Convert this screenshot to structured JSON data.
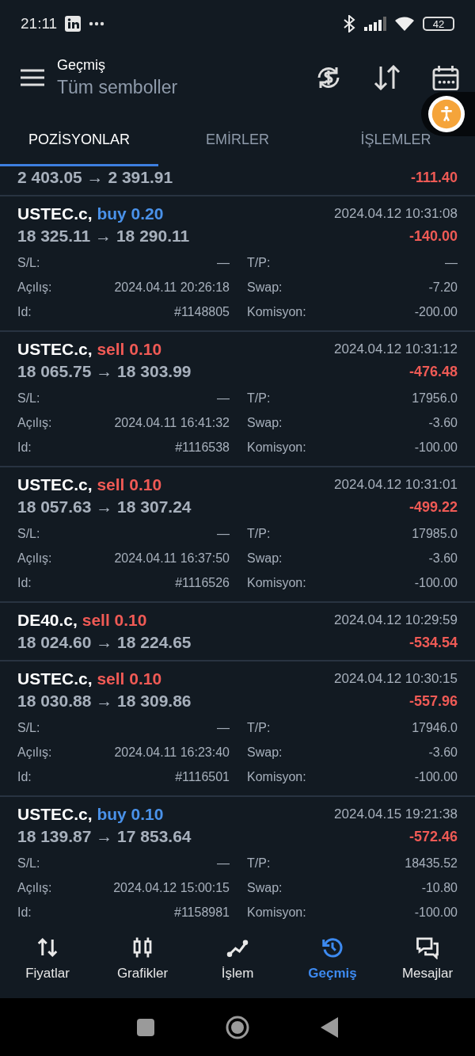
{
  "status_bar": {
    "time": "21:11",
    "battery": "42"
  },
  "header": {
    "title": "Geçmiş",
    "subtitle": "Tüm semboller"
  },
  "tabs": [
    {
      "label": "POZİSYONLAR",
      "selected": true
    },
    {
      "label": "EMİRLER",
      "selected": false
    },
    {
      "label": "İŞLEMLER",
      "selected": false
    }
  ],
  "deals": [
    {
      "kind": "partial",
      "prices": "2 403.05 → 2 391.91",
      "profit": "-111.40"
    },
    {
      "kind": "expanded",
      "symbol": "USTEC.c,",
      "sell": false,
      "order": "buy 0.20",
      "time": "2024.04.12 10:31:08",
      "prices": "18 325.11 → 18 290.11",
      "profit": "-140.00",
      "details": [
        {
          "label": "S/L:",
          "value": "—"
        },
        {
          "label": "T/P:",
          "value": "—"
        },
        {
          "label": "Açılış:",
          "value": "2024.04.11 20:26:18"
        },
        {
          "label": "Swap:",
          "value": "-7.20"
        },
        {
          "label": "Id:",
          "value": "#1148805"
        },
        {
          "label": "Komisyon:",
          "value": "-200.00"
        }
      ]
    },
    {
      "kind": "expanded",
      "symbol": "USTEC.c,",
      "sell": true,
      "order": "sell 0.10",
      "time": "2024.04.12 10:31:12",
      "prices": "18 065.75 → 18 303.99",
      "profit": "-476.48",
      "details": [
        {
          "label": "S/L:",
          "value": "—"
        },
        {
          "label": "T/P:",
          "value": "17956.0"
        },
        {
          "label": "Açılış:",
          "value": "2024.04.11 16:41:32"
        },
        {
          "label": "Swap:",
          "value": "-3.60"
        },
        {
          "label": "Id:",
          "value": "#1116538"
        },
        {
          "label": "Komisyon:",
          "value": "-100.00"
        }
      ]
    },
    {
      "kind": "expanded",
      "symbol": "USTEC.c,",
      "sell": true,
      "order": "sell 0.10",
      "time": "2024.04.12 10:31:01",
      "prices": "18 057.63 → 18 307.24",
      "profit": "-499.22",
      "details": [
        {
          "label": "S/L:",
          "value": "—"
        },
        {
          "label": "T/P:",
          "value": "17985.0"
        },
        {
          "label": "Açılış:",
          "value": "2024.04.11 16:37:50"
        },
        {
          "label": "Swap:",
          "value": "-3.60"
        },
        {
          "label": "Id:",
          "value": "#1116526"
        },
        {
          "label": "Komisyon:",
          "value": "-100.00"
        }
      ]
    },
    {
      "kind": "collapsed",
      "symbol": "DE40.c,",
      "sell": true,
      "order": "sell 0.10",
      "time": "2024.04.12 10:29:59",
      "prices": "18 024.60 → 18 224.65",
      "profit": "-534.54"
    },
    {
      "kind": "expanded",
      "symbol": "USTEC.c,",
      "sell": true,
      "order": "sell 0.10",
      "time": "2024.04.12 10:30:15",
      "prices": "18 030.88 → 18 309.86",
      "profit": "-557.96",
      "details": [
        {
          "label": "S/L:",
          "value": "—"
        },
        {
          "label": "T/P:",
          "value": "17946.0"
        },
        {
          "label": "Açılış:",
          "value": "2024.04.11 16:23:40"
        },
        {
          "label": "Swap:",
          "value": "-3.60"
        },
        {
          "label": "Id:",
          "value": "#1116501"
        },
        {
          "label": "Komisyon:",
          "value": "-100.00"
        }
      ]
    },
    {
      "kind": "expanded",
      "symbol": "USTEC.c,",
      "sell": false,
      "order": "buy 0.10",
      "time": "2024.04.15 19:21:38",
      "prices": "18 139.87 → 17 853.64",
      "profit": "-572.46",
      "details": [
        {
          "label": "S/L:",
          "value": "—"
        },
        {
          "label": "T/P:",
          "value": "18435.52"
        },
        {
          "label": "Açılış:",
          "value": "2024.04.12 15:00:15"
        },
        {
          "label": "Swap:",
          "value": "-10.80"
        },
        {
          "label": "Id:",
          "value": "#1158981"
        },
        {
          "label": "Komisyon:",
          "value": "-100.00"
        }
      ]
    }
  ],
  "bottom_nav": [
    {
      "label": "Fiyatlar",
      "selected": false
    },
    {
      "label": "Grafikler",
      "selected": false
    },
    {
      "label": "İşlem",
      "selected": false
    },
    {
      "label": "Geçmiş",
      "selected": true
    },
    {
      "label": "Mesajlar",
      "selected": false
    }
  ]
}
